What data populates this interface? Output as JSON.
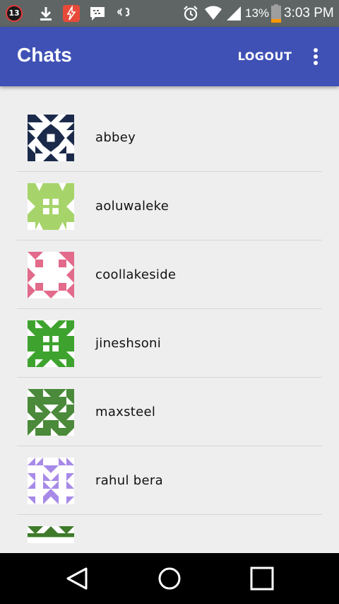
{
  "status_bar": {
    "notification_count": "13",
    "battery_percent": "13%",
    "time": "3:03 PM",
    "icons": [
      "notification-badge-icon",
      "download-icon",
      "flashlight-icon",
      "bbm-icon",
      "vibrate-icon",
      "alarm-icon",
      "wifi-icon",
      "signal-icon",
      "battery-icon"
    ]
  },
  "app_bar": {
    "title": "Chats",
    "logout_label": "LOGOUT",
    "overflow_icon": "more-vert-icon",
    "color": "#3f51b5"
  },
  "chats": [
    {
      "name": "abbey",
      "avatar_color": "#1b2a4a"
    },
    {
      "name": "aoluwaleke",
      "avatar_color": "#a6d46a"
    },
    {
      "name": "coollakeside",
      "avatar_color": "#e26a8a"
    },
    {
      "name": "jineshsoni",
      "avatar_color": "#3ea32e"
    },
    {
      "name": "maxsteel",
      "avatar_color": "#4a8a3a"
    },
    {
      "name": "rahul bera",
      "avatar_color": "#a78ae8"
    },
    {
      "name": "",
      "avatar_color": "#3e7a2a"
    }
  ],
  "nav_bar": {
    "icons": [
      "back-icon",
      "home-icon",
      "recents-icon"
    ]
  }
}
